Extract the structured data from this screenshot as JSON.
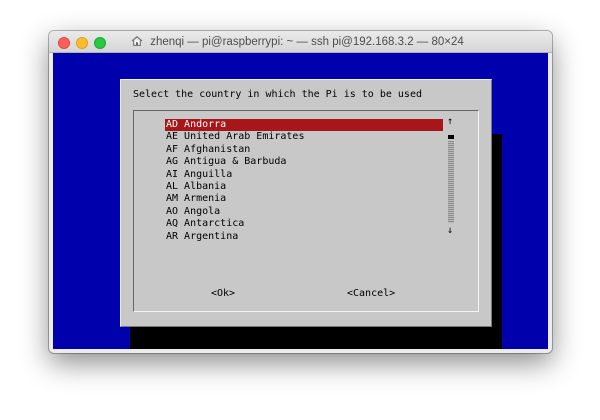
{
  "window": {
    "title": "zhenqi — pi@raspberrypi: ~ — ssh pi@192.168.3.2 — 80×24",
    "title_icon": "home-icon"
  },
  "dialog": {
    "prompt": "Select the country in which the Pi is to be used",
    "countries": [
      "AD Andorra",
      "AE United Arab Emirates",
      "AF Afghanistan",
      "AG Antigua & Barbuda",
      "AI Anguilla",
      "AL Albania",
      "AM Armenia",
      "AO Angola",
      "AQ Antarctica",
      "AR Argentina"
    ],
    "selected_index": 0,
    "scroll": {
      "up": "↑",
      "down": "↓"
    },
    "buttons": {
      "ok": "<Ok>",
      "cancel": "<Cancel>"
    }
  },
  "colors": {
    "terminal_background": "#0000ad",
    "dialog_background": "#c8c8c8",
    "selection_background": "#a7171a",
    "selection_text": "#ffffff"
  }
}
